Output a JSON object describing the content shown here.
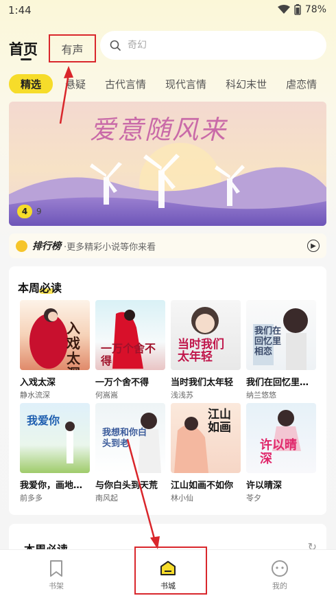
{
  "status": {
    "time": "1:44",
    "battery": "78%"
  },
  "header": {
    "home_tab": "首页",
    "audio_tab": "有声",
    "search_placeholder": "奇幻"
  },
  "categories": [
    "精选",
    "悬疑",
    "古代言情",
    "现代言情",
    "科幻末世",
    "虐恋情"
  ],
  "banner": {
    "title": "爱意随风来",
    "current": "4",
    "total": "9"
  },
  "ranking": {
    "title": "排行榜",
    "subtitle": "·更多精彩小说等你来看"
  },
  "weekly": {
    "title": "本周必读",
    "books": [
      {
        "title": "入戏太深",
        "author": "静水流深",
        "cover_text": "入戏太深"
      },
      {
        "title": "一万个舍不得",
        "author": "何嵩嵩",
        "cover_text": "一万个舍不得"
      },
      {
        "title": "当时我们太年轻",
        "author": "浅浅苏",
        "cover_text": "当时我们太年轻"
      },
      {
        "title": "我们在回忆里相...",
        "author": "纳兰悠悠",
        "cover_text": "我们在回忆里相恋"
      },
      {
        "title": "我爱你，画地为...",
        "author": "前多多",
        "cover_text": "我爱你"
      },
      {
        "title": "与你白头到天荒",
        "author": "南风起",
        "cover_text": "我想和你白头到老"
      },
      {
        "title": "江山如画不如你",
        "author": "林小仙",
        "cover_text": "江山如画"
      },
      {
        "title": "许以晴深",
        "author": "苓夕",
        "cover_text": "许以晴深"
      }
    ]
  },
  "weekly2": {
    "title": "本周必读"
  },
  "nav": {
    "shelf": "书架",
    "store": "书城",
    "mine": "我的"
  },
  "colors": {
    "accent": "#f6dc2a",
    "annotation": "#d9262b"
  }
}
